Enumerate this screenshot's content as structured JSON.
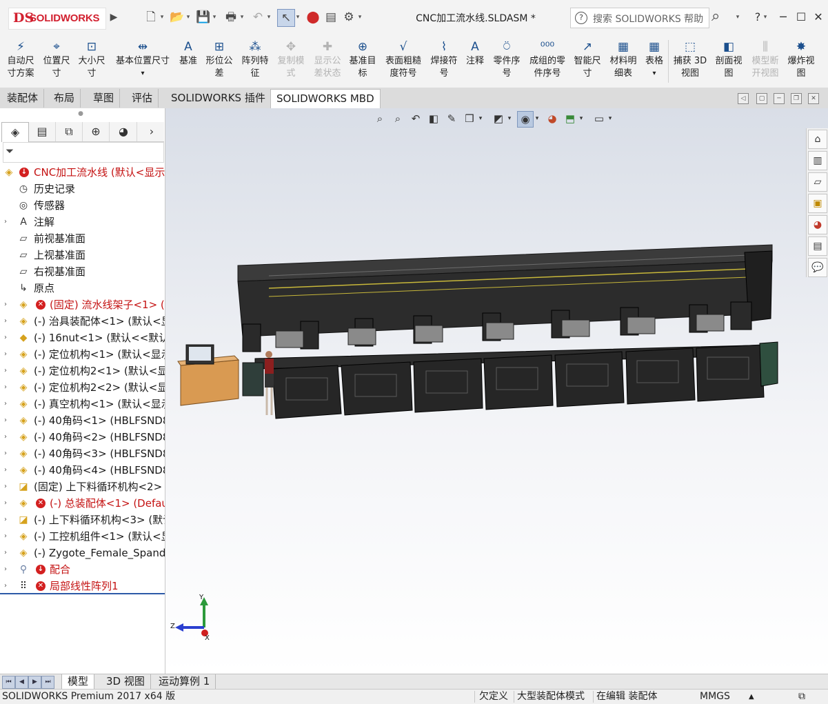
{
  "titlebar": {
    "logo_ds": "DS",
    "logo_text": "SOLIDWORKS",
    "doc_title": "CNC加工流水线.SLDASM *",
    "search_placeholder": "搜索 SOLIDWORKS 帮助",
    "help_label": "?"
  },
  "commands": [
    {
      "label": "自动尺\n寸方案",
      "icon": "auto-dimension-icon",
      "enabled": true
    },
    {
      "label": "位置尺\n寸",
      "icon": "location-dimension-icon",
      "enabled": true
    },
    {
      "label": "大小尺\n寸",
      "icon": "size-dimension-icon",
      "enabled": true
    },
    {
      "label": "基本位置尺寸",
      "icon": "basic-location-dimension-icon",
      "enabled": true
    },
    {
      "label": "基准",
      "icon": "datum-icon",
      "enabled": true
    },
    {
      "label": "形位公\n差",
      "icon": "geometric-tolerance-icon",
      "enabled": true
    },
    {
      "label": "阵列特\n征",
      "icon": "pattern-feature-icon",
      "enabled": true
    },
    {
      "label": "复制模\n式",
      "icon": "copy-scheme-icon",
      "enabled": false
    },
    {
      "label": "显示公\n差状态",
      "icon": "tolerance-status-icon",
      "enabled": false
    },
    {
      "label": "基准目\n标",
      "icon": "datum-target-icon",
      "enabled": true
    },
    {
      "label": "表面粗糙\n度符号",
      "icon": "surface-finish-icon",
      "enabled": true
    },
    {
      "label": "焊接符\n号",
      "icon": "weld-symbol-icon",
      "enabled": true
    },
    {
      "label": "注释",
      "icon": "note-icon",
      "enabled": true
    },
    {
      "label": "零件序\n号",
      "icon": "balloon-icon",
      "enabled": true
    },
    {
      "label": "成组的零\n件序号",
      "icon": "stacked-balloon-icon",
      "enabled": true
    },
    {
      "label": "智能尺\n寸",
      "icon": "smart-dimension-icon",
      "enabled": true
    },
    {
      "label": "材料明\n细表",
      "icon": "bom-icon",
      "enabled": true
    },
    {
      "label": "表格",
      "icon": "table-icon",
      "enabled": true
    },
    {
      "label": "捕获 3D\n视图",
      "icon": "capture-3d-view-icon",
      "enabled": true
    },
    {
      "label": "剖面视\n图",
      "icon": "section-view-icon",
      "enabled": true
    },
    {
      "label": "模型断\n开视图",
      "icon": "model-break-view-icon",
      "enabled": false
    },
    {
      "label": "爆炸视\n图",
      "icon": "exploded-view-icon",
      "enabled": true
    }
  ],
  "cmd_tabs": [
    "装配体",
    "布局",
    "草图",
    "评估",
    "SOLIDWORKS 插件",
    "SOLIDWORKS MBD"
  ],
  "active_cmd_tab": "SOLIDWORKS MBD",
  "tree": [
    {
      "label": "CNC加工流水线  (默认<显示",
      "icon": "assembly-icon",
      "error": true,
      "expander": false,
      "red": true
    },
    {
      "label": "历史记录",
      "icon": "history-icon",
      "error": false,
      "expander": false,
      "red": false
    },
    {
      "label": "传感器",
      "icon": "sensor-icon",
      "error": false,
      "expander": false,
      "red": false
    },
    {
      "label": "注解",
      "icon": "annotation-icon",
      "error": false,
      "expander": true,
      "red": false
    },
    {
      "label": "前视基准面",
      "icon": "plane-icon",
      "error": false,
      "expander": false,
      "red": false
    },
    {
      "label": "上视基准面",
      "icon": "plane-icon",
      "error": false,
      "expander": false,
      "red": false
    },
    {
      "label": "右视基准面",
      "icon": "plane-icon",
      "error": false,
      "expander": false,
      "red": false
    },
    {
      "label": "原点",
      "icon": "origin-icon",
      "error": false,
      "expander": false,
      "red": false
    },
    {
      "label": "(固定) 流水线架子<1> (默",
      "icon": "assembly-icon",
      "error": true,
      "expander": true,
      "red": true
    },
    {
      "label": "(-) 治具装配体<1> (默认<显",
      "icon": "assembly-icon",
      "error": false,
      "expander": true,
      "red": false
    },
    {
      "label": "(-) 16nut<1> (默认<<默认:",
      "icon": "part-icon",
      "error": false,
      "expander": true,
      "red": false
    },
    {
      "label": "(-) 定位机构<1> (默认<显示",
      "icon": "assembly-icon",
      "error": false,
      "expander": true,
      "red": false
    },
    {
      "label": "(-) 定位机构2<1> (默认<显",
      "icon": "assembly-icon",
      "error": false,
      "expander": true,
      "red": false
    },
    {
      "label": "(-) 定位机构2<2> (默认<显",
      "icon": "assembly-icon",
      "error": false,
      "expander": true,
      "red": false
    },
    {
      "label": "(-) 真空机构<1> (默认<显示",
      "icon": "assembly-icon",
      "error": false,
      "expander": true,
      "red": false
    },
    {
      "label": "(-) 40角码<1> (HBLFSND8",
      "icon": "assembly-icon",
      "error": false,
      "expander": true,
      "red": false
    },
    {
      "label": "(-) 40角码<2> (HBLFSND8",
      "icon": "assembly-icon",
      "error": false,
      "expander": true,
      "red": false
    },
    {
      "label": "(-) 40角码<3> (HBLFSND8",
      "icon": "assembly-icon",
      "error": false,
      "expander": true,
      "red": false
    },
    {
      "label": "(-) 40角码<4> (HBLFSND8",
      "icon": "assembly-icon",
      "error": false,
      "expander": true,
      "red": false
    },
    {
      "label": "(固定) 上下料循环机构<2> (",
      "icon": "flex-assembly-icon",
      "error": false,
      "expander": true,
      "red": false
    },
    {
      "label": "(-) 总装配体<1> (Default",
      "icon": "assembly-icon",
      "error": true,
      "expander": true,
      "red": true
    },
    {
      "label": "(-) 上下料循环机构<3> (默认",
      "icon": "flex-assembly-icon",
      "error": false,
      "expander": true,
      "red": false
    },
    {
      "label": "(-) 工控机组件<1> (默认<显",
      "icon": "assembly-icon",
      "error": false,
      "expander": true,
      "red": false
    },
    {
      "label": "(-) Zygote_Female_Spande",
      "icon": "assembly-icon",
      "error": false,
      "expander": true,
      "red": false
    },
    {
      "label": "配合",
      "icon": "mates-icon",
      "error": true,
      "expander": true,
      "red": true
    },
    {
      "label": "局部线性阵列1",
      "icon": "linear-pattern-icon",
      "error": true,
      "expander": true,
      "red": true
    }
  ],
  "triad": {
    "x": "X",
    "y": "Y",
    "z": "Z"
  },
  "bottom_tabs": [
    "模型",
    "3D 视图",
    "运动算例 1"
  ],
  "status": {
    "app": "SOLIDWORKS Premium 2017 x64 版",
    "underdefined": "欠定义",
    "mode": "大型装配体模式",
    "editing": "在编辑 装配体",
    "units": "MMGS"
  },
  "colors": {
    "brand_red": "#d2202f",
    "error_red": "#d32020",
    "link_blue": "#2d5aa7"
  }
}
